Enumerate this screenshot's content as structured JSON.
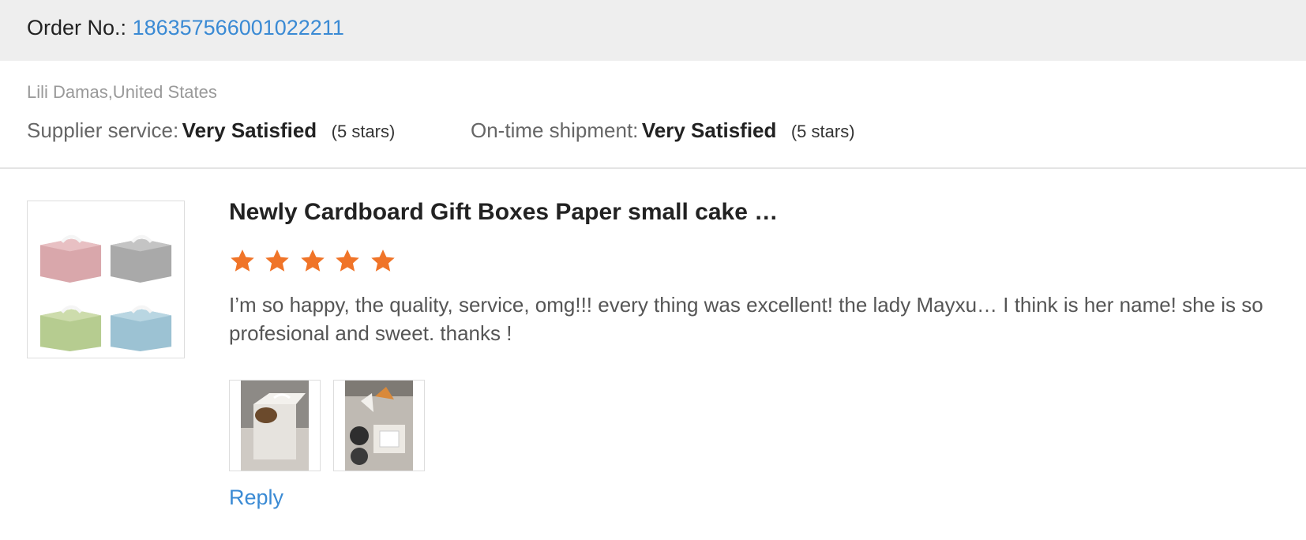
{
  "order": {
    "label": "Order No.:",
    "number": "186357566001022211"
  },
  "reviewer": {
    "name_location": "Lili Damas,United States"
  },
  "ratings": {
    "supplier_service": {
      "label": "Supplier service:",
      "value": "Very Satisfied",
      "stars_text": "(5 stars)"
    },
    "ontime_shipment": {
      "label": "On-time shipment:",
      "value": "Very Satisfied",
      "stars_text": "(5 stars)"
    }
  },
  "review": {
    "product_title": "Newly Cardboard Gift Boxes Paper small cake …",
    "star_rating": 5,
    "star_max": 5,
    "star_color": "#f07428",
    "text": "I’m so happy, the quality, service, omg!!! every thing was excellent! the lady Mayxu… I think is her name! she is so profesional and sweet. thanks !",
    "photos": [
      "review-photo-cake-box",
      "review-photo-packaged-items"
    ],
    "reply_label": "Reply"
  },
  "colors": {
    "link": "#3a8ad4",
    "order_bar": "#eeeeee",
    "muted_text": "#999999"
  }
}
